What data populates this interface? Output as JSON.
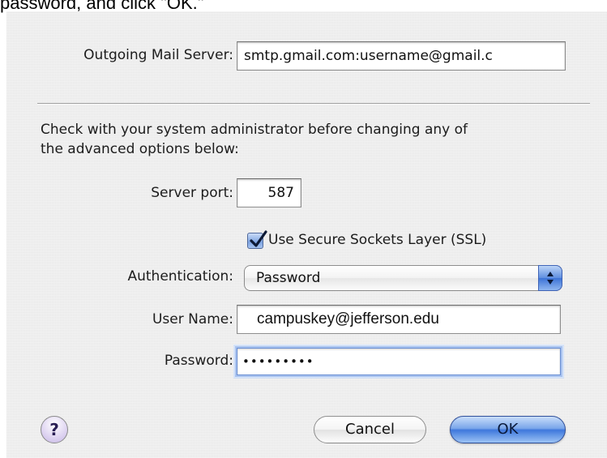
{
  "caption": "password, and click \"OK.\"",
  "dialog": {
    "outgoing_server": {
      "label": "Outgoing Mail Server:",
      "value": "smtp.gmail.com:username@gmail.c"
    },
    "advisory": {
      "line1": "Check with your system administrator before changing any of",
      "line2": "the advanced options below:"
    },
    "server_port": {
      "label": "Server port:",
      "value": "587"
    },
    "ssl": {
      "label": "Use Secure Sockets Layer (SSL)",
      "checked": true
    },
    "authentication": {
      "label": "Authentication:",
      "selected": "Password"
    },
    "user_name": {
      "label": "User Name:",
      "value": "campuskey@jefferson.edu"
    },
    "password": {
      "label": "Password:",
      "value": "•••••••••"
    },
    "help_button": {
      "label": "?"
    },
    "buttons": {
      "cancel": "Cancel",
      "ok": "OK"
    },
    "colors": {
      "accent": "#5e8ee0",
      "focus_ring": "#a9c3ef"
    },
    "icons": {
      "checkbox": "checkmark-icon",
      "popup": "updown-arrows-icon",
      "help": "question-mark-icon"
    }
  }
}
